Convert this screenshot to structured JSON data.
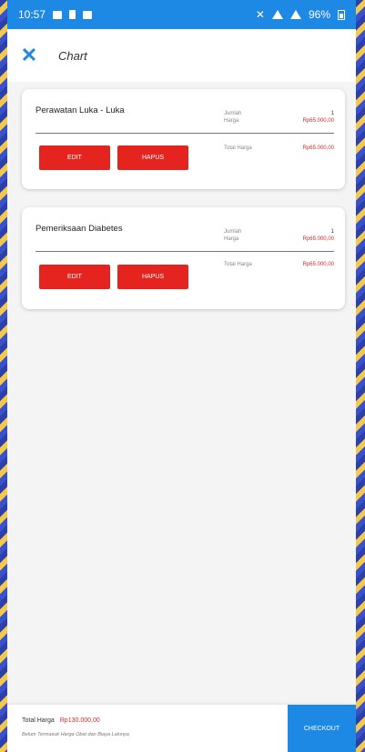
{
  "status": {
    "time": "10:57",
    "battery": "96%"
  },
  "appbar": {
    "title": "Chart"
  },
  "cart_items": [
    {
      "name": "Perawatan Luka - Luka",
      "edit_label": "EDIT",
      "delete_label": "HAPUS",
      "qty_label": "Jumlah",
      "qty_value": "1",
      "price_label": "Harga",
      "price_value": "Rp65.000,00",
      "total_label": "Total Harga",
      "total_value": "Rp65.000,00"
    },
    {
      "name": "Pemeriksaan Diabetes",
      "edit_label": "EDIT",
      "delete_label": "HAPUS",
      "qty_label": "Jumlah",
      "qty_value": "1",
      "price_label": "Harga",
      "price_value": "Rp65.000,00",
      "total_label": "Total Harga",
      "total_value": "Rp65.000,00"
    }
  ],
  "footer": {
    "total_label": "Total Harga",
    "total_value": "Rp130.000,00",
    "note": "Belum Termasuk Harga Obat dan Biaya Lainnya",
    "checkout_label": "CHECKOUT"
  }
}
